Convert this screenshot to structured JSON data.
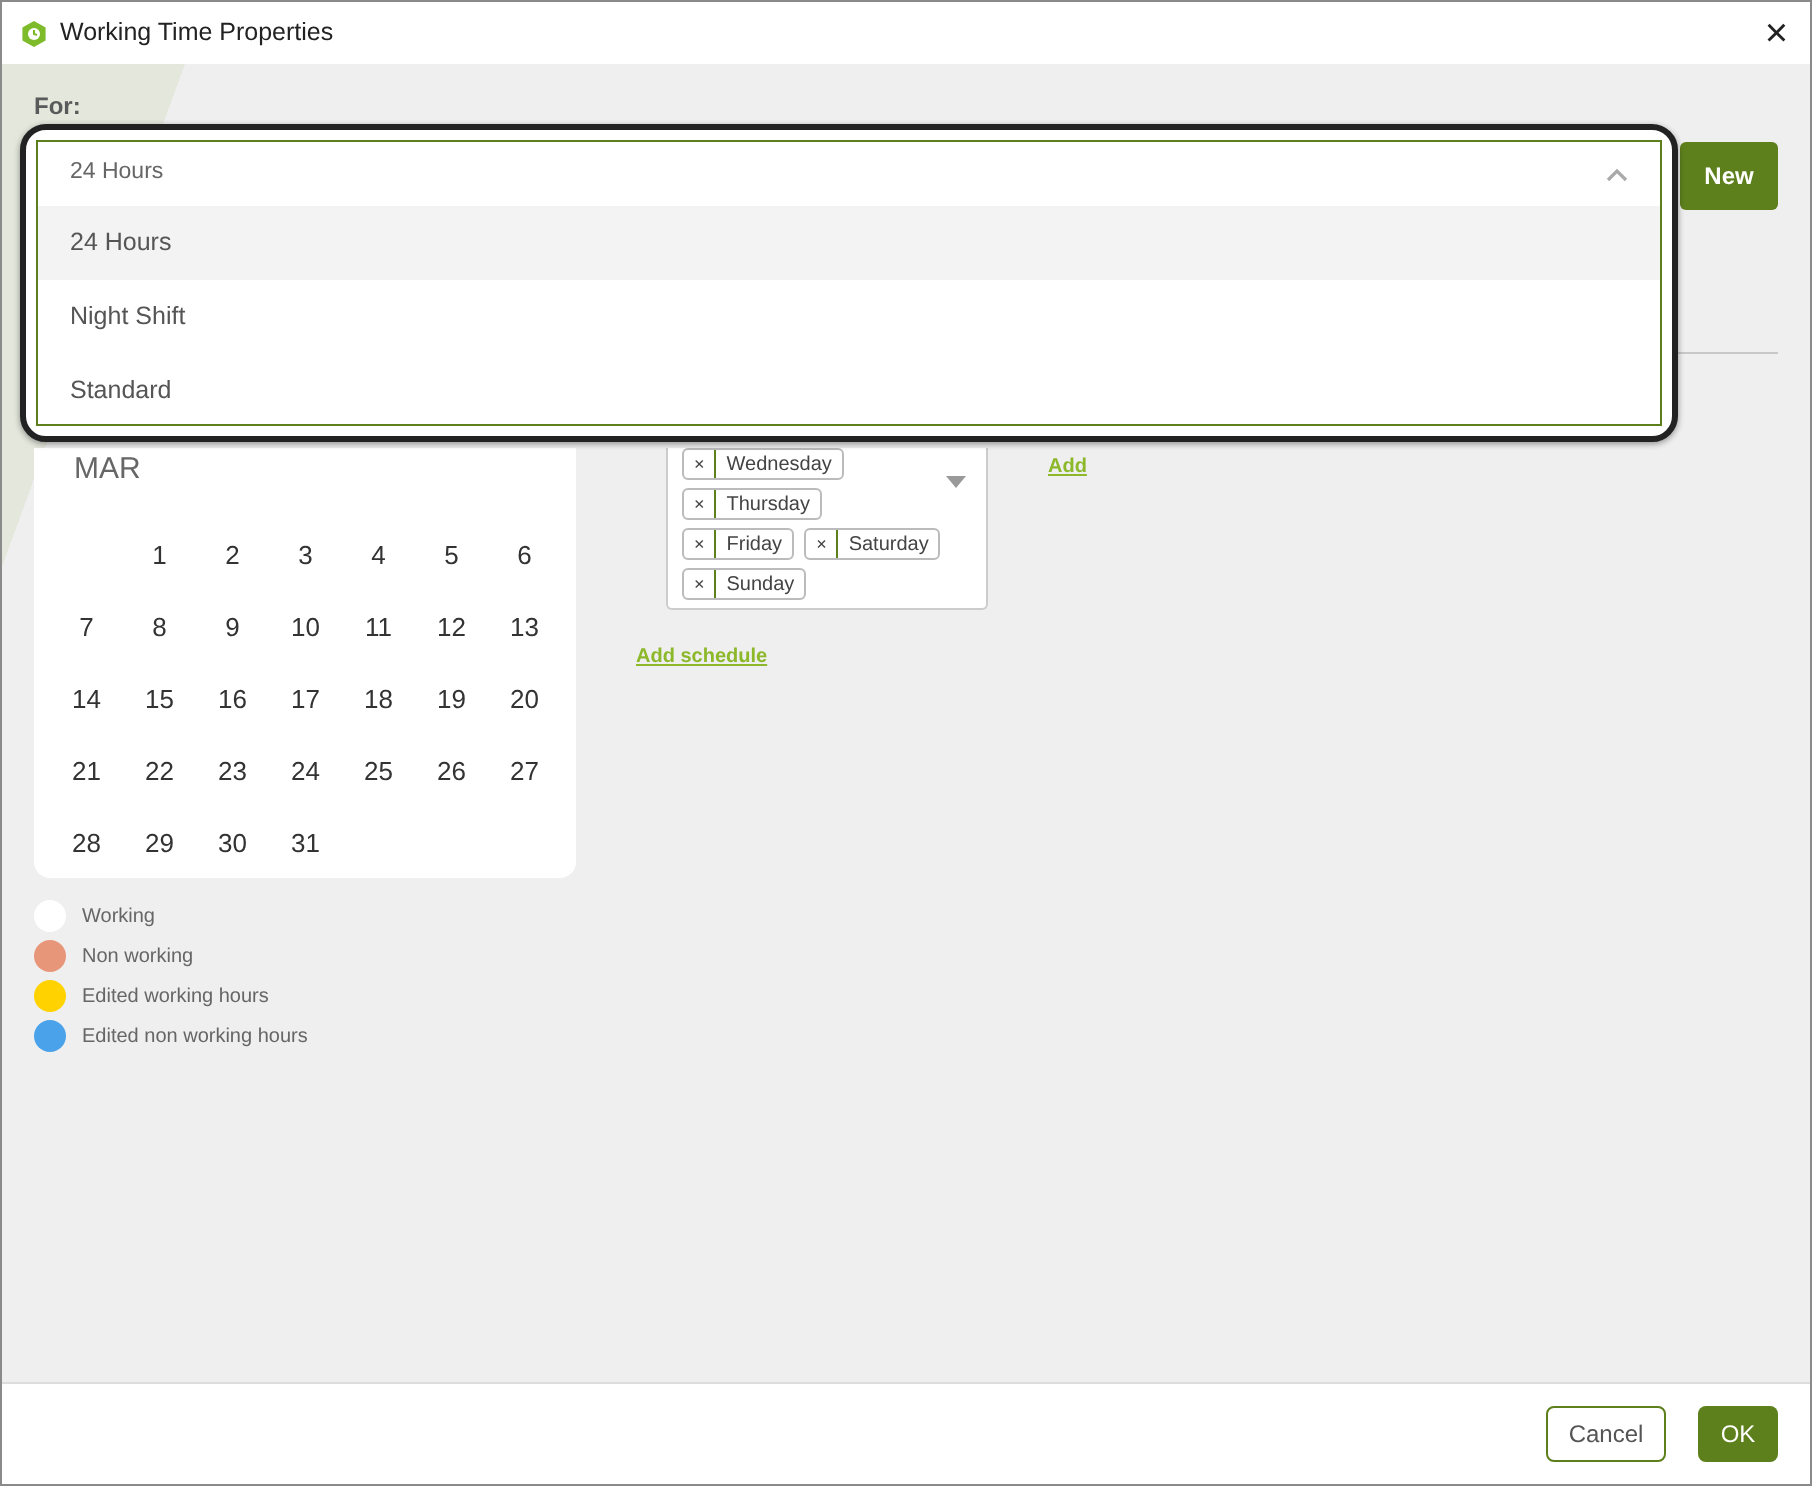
{
  "window": {
    "title": "Working Time Properties",
    "close": "×"
  },
  "for_field": {
    "label": "For:",
    "value": "24 Hours",
    "expanded": true,
    "options": [
      {
        "label": "24 Hours",
        "selected": true
      },
      {
        "label": "Night Shift",
        "selected": false
      },
      {
        "label": "Standard",
        "selected": false
      }
    ]
  },
  "new_button": "New",
  "calendar": {
    "month": "MAR",
    "weeks": [
      [
        "1",
        "2",
        "3",
        "4",
        "5",
        "6"
      ],
      [
        "7",
        "8",
        "9",
        "10",
        "11",
        "12",
        "13"
      ],
      [
        "14",
        "15",
        "16",
        "17",
        "18",
        "19",
        "20"
      ],
      [
        "21",
        "22",
        "23",
        "24",
        "25",
        "26",
        "27"
      ],
      [
        "28",
        "29",
        "30",
        "31"
      ]
    ]
  },
  "schedule": {
    "days": [
      {
        "label": "Wednesday",
        "remove": "×"
      },
      {
        "label": "Thursday",
        "remove": "×"
      },
      {
        "label": "Friday",
        "remove": "×"
      },
      {
        "label": "Saturday",
        "remove": "×"
      },
      {
        "label": "Sunday",
        "remove": "×"
      }
    ],
    "add": "Add",
    "add_schedule": "Add schedule"
  },
  "legend": [
    {
      "label": "Working",
      "color": "#ffffff"
    },
    {
      "label": "Non working",
      "color": "#e8967a"
    },
    {
      "label": "Edited working hours",
      "color": "#ffd200"
    },
    {
      "label": "Edited non working hours",
      "color": "#4aa3ea"
    }
  ],
  "footer": {
    "cancel": "Cancel",
    "ok": "OK"
  }
}
